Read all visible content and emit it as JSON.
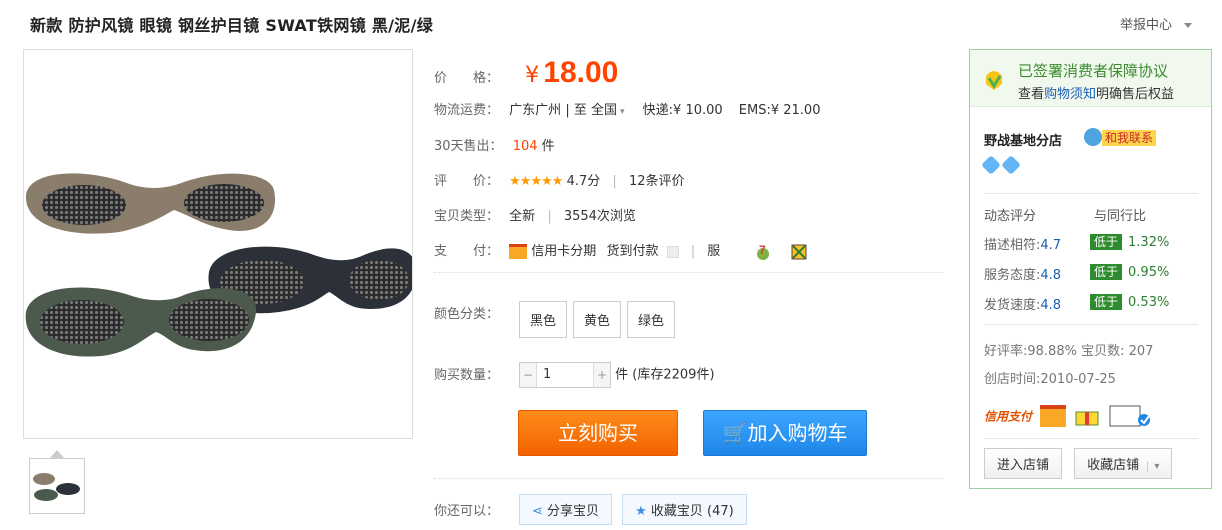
{
  "header": {
    "title": "新款 防护风镜 眼镜 钢丝护目镜 SWAT铁网镜 黑/泥/绿",
    "report_label": "举报中心"
  },
  "product": {
    "price_label": "价　　格：",
    "price_symbol": "¥",
    "price": "18.00",
    "shipping_label": "物流运费：",
    "shipping_from": "广东广州",
    "shipping_to_sep": "| 至",
    "shipping_to": "全国",
    "express": "快递:¥ 10.00",
    "ems": "EMS:¥ 21.00",
    "sold_label": "30天售出：",
    "sold_count": "104",
    "sold_unit": "件",
    "rating_label": "评　　价：",
    "rating_score": "4.7分",
    "review_count": "12条评价",
    "rating_stars": 4.7,
    "type_label": "宝贝类型：",
    "condition": "全新",
    "views": "3554次浏览",
    "payment_label": "支　　付：",
    "payment_installment": "信用卡分期",
    "payment_cod": "货到付款",
    "service_label": "服",
    "color_label": "颜色分类：",
    "colors": [
      "黑色",
      "黄色",
      "绿色"
    ],
    "qty_label": "购买数量：",
    "qty_minus": "−",
    "qty_value": "1",
    "qty_plus": "+",
    "qty_unit": "件",
    "stock": "(库存2209件)",
    "buy_now": "立刻购买",
    "add_cart": "加入购物车",
    "also_label": "你还可以：",
    "share": "分享宝贝",
    "favorite": "收藏宝贝 (47)"
  },
  "seller": {
    "protection_title": "已签署消费者保障协议",
    "protection_sub_pre": "查看",
    "protection_link": "购物须知",
    "protection_sub_post": "明确售后权益",
    "shop_name": "野战基地分店",
    "contact_label": "和我联系",
    "dynamic_label": "动态评分",
    "compare_label": "与同行比",
    "scores": [
      {
        "label": "描述相符:",
        "value": "4.7",
        "badge": "低于",
        "diff": "1.32%"
      },
      {
        "label": "服务态度:",
        "value": "4.8",
        "badge": "低于",
        "diff": "0.95%"
      },
      {
        "label": "发货速度:",
        "value": "4.8",
        "badge": "低于",
        "diff": "0.53%"
      }
    ],
    "positive_rate": "好评率:98.88%",
    "item_count": "宝贝数: 207",
    "founded": "创店时间:2010-07-25",
    "credit_pay": "信用支付",
    "enter_shop": "进入店铺",
    "fav_shop": "收藏店铺"
  },
  "colors": {
    "accent_orange": "#ff4400",
    "green_border": "#9fd29f",
    "score_badge": "#2e8b2e"
  }
}
